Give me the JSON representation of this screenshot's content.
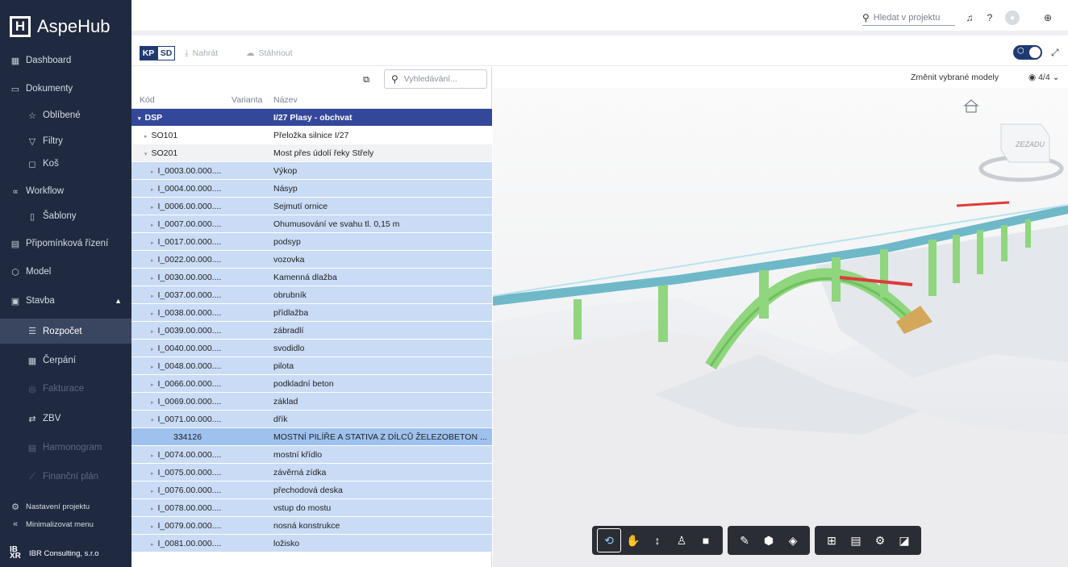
{
  "app": {
    "name": "AspeHub",
    "logo_letter": "H"
  },
  "topbar": {
    "search_placeholder": "Hledat v projektu"
  },
  "sidebar": {
    "items": [
      {
        "label": "Dashboard",
        "icon": "dashboard-icon"
      },
      {
        "label": "Dokumenty",
        "icon": "folder-icon"
      },
      {
        "label": "Oblíbené",
        "icon": "star-icon"
      },
      {
        "label": "Filtry",
        "icon": "filter-icon"
      },
      {
        "label": "Koš",
        "icon": "trash-icon"
      },
      {
        "label": "Workflow",
        "icon": "workflow-icon"
      },
      {
        "label": "Šablony",
        "icon": "template-icon"
      },
      {
        "label": "Připomínková řízení",
        "icon": "review-icon"
      },
      {
        "label": "Model",
        "icon": "cube-icon"
      },
      {
        "label": "Stavba",
        "icon": "construction-icon"
      },
      {
        "label": "Rozpočet",
        "icon": "list-icon"
      },
      {
        "label": "Čerpání",
        "icon": "calendar-icon"
      },
      {
        "label": "Fakturace",
        "icon": "coin-icon"
      },
      {
        "label": "ZBV",
        "icon": "swap-icon"
      },
      {
        "label": "Harmonogram",
        "icon": "gantt-icon"
      },
      {
        "label": "Finanční plán",
        "icon": "chart-icon"
      },
      {
        "label": "Nastavení projektu",
        "icon": "gear-icon"
      },
      {
        "label": "Minimalizovat menu",
        "icon": "collapse-icon"
      }
    ],
    "company": {
      "mark": "IB XR",
      "label": "IBR Consulting, s.r.o"
    }
  },
  "toolbar": {
    "tab_kp": "KP",
    "tab_sd": "SD",
    "upload_label": "Nahrát",
    "download_label": "Stáhnout"
  },
  "tree": {
    "search_placeholder": "Vyhledávání...",
    "columns": {
      "code": "Kód",
      "variant": "Varianta",
      "name": "Název"
    },
    "rows": [
      {
        "code": "DSP",
        "name": "I/27 Plasy - obchvat"
      },
      {
        "code": "SO101",
        "name": "Přeložka silnice I/27"
      },
      {
        "code": "SO201",
        "name": "Most přes údolí řeky Střely"
      },
      {
        "code": "I_0003.00.000....",
        "name": "Výkop"
      },
      {
        "code": "I_0004.00.000....",
        "name": "Násyp"
      },
      {
        "code": "I_0006.00.000....",
        "name": "Sejmutí ornice"
      },
      {
        "code": "I_0007.00.000....",
        "name": "Ohumusování ve svahu tl. 0,15 m"
      },
      {
        "code": "I_0017.00.000....",
        "name": "podsyp"
      },
      {
        "code": "I_0022.00.000....",
        "name": "vozovka"
      },
      {
        "code": "I_0030.00.000....",
        "name": "Kamenná dlažba"
      },
      {
        "code": "I_0037.00.000....",
        "name": "obrubník"
      },
      {
        "code": "I_0038.00.000....",
        "name": "přídlažba"
      },
      {
        "code": "I_0039.00.000....",
        "name": "zábradlí"
      },
      {
        "code": "I_0040.00.000....",
        "name": "svodidlo"
      },
      {
        "code": "I_0048.00.000....",
        "name": "pilota"
      },
      {
        "code": "I_0066.00.000....",
        "name": "podkladní beton"
      },
      {
        "code": "I_0069.00.000....",
        "name": "základ"
      },
      {
        "code": "I_0071.00.000....",
        "name": "dřík"
      },
      {
        "code": "334126",
        "name": "MOSTNÍ PILÍŘE A STATIVA Z DÍLCŮ ŽELEZOBETON ..."
      },
      {
        "code": "I_0074.00.000....",
        "name": "mostní křídlo"
      },
      {
        "code": "I_0075.00.000....",
        "name": "závěrná zídka"
      },
      {
        "code": "I_0076.00.000....",
        "name": "přechodová deska"
      },
      {
        "code": "I_0078.00.000....",
        "name": "vstup do mostu"
      },
      {
        "code": "I_0079.00.000....",
        "name": "nosná konstrukce"
      },
      {
        "code": "I_0081.00.000....",
        "name": "ložisko"
      }
    ]
  },
  "viewer": {
    "change_models_label": "Změnit vybrané modely",
    "model_count": "4/4",
    "viewcube_label": "ZEZADU"
  }
}
